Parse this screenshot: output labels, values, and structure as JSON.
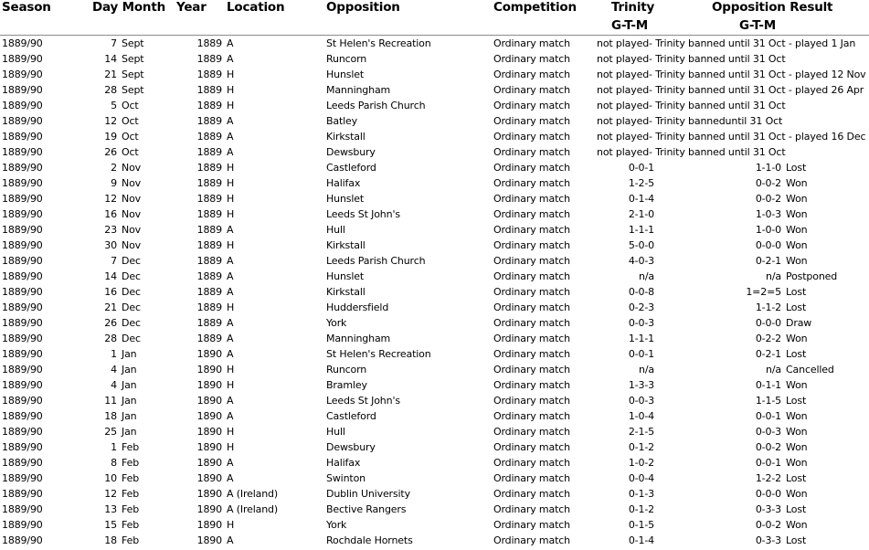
{
  "headers": {
    "season": "Season",
    "day_month": "Day Month",
    "year": "Year",
    "location": "Location",
    "opposition": "Opposition",
    "competition": "Competition",
    "trinity": "Trinity",
    "trinity_sub": "G-T-M",
    "opposition_result": "Opposition Result",
    "opposition_sub": "G-T-M"
  },
  "rows": [
    {
      "season": "1889/90",
      "day": "7",
      "month": "Sept",
      "year": "1889",
      "location": "A",
      "opposition": "St Helen's Recreation",
      "competition": "Ordinary match",
      "note": "not played- Trinity banned until 31 Oct - played 1 Jan"
    },
    {
      "season": "1889/90",
      "day": "14",
      "month": "Sept",
      "year": "1889",
      "location": "A",
      "opposition": "Runcorn",
      "competition": "Ordinary match",
      "note": "not played- Trinity banned until 31 Oct"
    },
    {
      "season": "1889/90",
      "day": "21",
      "month": "Sept",
      "year": "1889",
      "location": "H",
      "opposition": "Hunslet",
      "competition": "Ordinary match",
      "note": "not played- Trinity banned until 31 Oct - played 12 Nov"
    },
    {
      "season": "1889/90",
      "day": "28",
      "month": "Sept",
      "year": "1889",
      "location": "H",
      "opposition": "Manningham",
      "competition": "Ordinary match",
      "note": "not played- Trinity banned until 31 Oct - played 26 Apr"
    },
    {
      "season": "1889/90",
      "day": "5",
      "month": "Oct",
      "year": "1889",
      "location": "H",
      "opposition": "Leeds Parish Church",
      "competition": "Ordinary match",
      "note": "not played- Trinity banned until 31 Oct"
    },
    {
      "season": "1889/90",
      "day": "12",
      "month": "Oct",
      "year": "1889",
      "location": "A",
      "opposition": "Batley",
      "competition": "Ordinary match",
      "note": "not played- Trinity banneduntil 31 Oct"
    },
    {
      "season": "1889/90",
      "day": "19",
      "month": "Oct",
      "year": "1889",
      "location": "A",
      "opposition": "Kirkstall",
      "competition": "Ordinary match",
      "note": "not played- Trinity banned until 31 Oct - played 16 Dec"
    },
    {
      "season": "1889/90",
      "day": "26",
      "month": "Oct",
      "year": "1889",
      "location": "A",
      "opposition": "Dewsbury",
      "competition": "Ordinary match",
      "note": "not played- Trinity banned until 31 Oct"
    },
    {
      "season": "1889/90",
      "day": "2",
      "month": "Nov",
      "year": "1889",
      "location": "H",
      "opposition": "Castleford",
      "competition": "Ordinary match",
      "trinity": "0-0-1",
      "opp_score": "1-1-0",
      "result": "Lost"
    },
    {
      "season": "1889/90",
      "day": "9",
      "month": "Nov",
      "year": "1889",
      "location": "H",
      "opposition": "Halifax",
      "competition": "Ordinary match",
      "trinity": "1-2-5",
      "opp_score": "0-0-2",
      "result": "Won"
    },
    {
      "season": "1889/90",
      "day": "12",
      "month": "Nov",
      "year": "1889",
      "location": "H",
      "opposition": "Hunslet",
      "competition": "Ordinary match",
      "trinity": "0-1-4",
      "opp_score": "0-0-2",
      "result": "Won"
    },
    {
      "season": "1889/90",
      "day": "16",
      "month": "Nov",
      "year": "1889",
      "location": "H",
      "opposition": "Leeds St John's",
      "competition": "Ordinary match",
      "trinity": "2-1-0",
      "opp_score": "1-0-3",
      "result": "Won"
    },
    {
      "season": "1889/90",
      "day": "23",
      "month": "Nov",
      "year": "1889",
      "location": "A",
      "opposition": "Hull",
      "competition": "Ordinary match",
      "trinity": "1-1-1",
      "opp_score": "1-0-0",
      "result": "Won"
    },
    {
      "season": "1889/90",
      "day": "30",
      "month": "Nov",
      "year": "1889",
      "location": "H",
      "opposition": "Kirkstall",
      "competition": "Ordinary match",
      "trinity": "5-0-0",
      "opp_score": "0-0-0",
      "result": "Won"
    },
    {
      "season": "1889/90",
      "day": "7",
      "month": "Dec",
      "year": "1889",
      "location": "A",
      "opposition": "Leeds Parish Church",
      "competition": "Ordinary match",
      "trinity": "4-0-3",
      "opp_score": "0-2-1",
      "result": "Won"
    },
    {
      "season": "1889/90",
      "day": "14",
      "month": "Dec",
      "year": "1889",
      "location": "A",
      "opposition": "Hunslet",
      "competition": "Ordinary match",
      "trinity": "n/a",
      "opp_score": "n/a",
      "result": "Postponed"
    },
    {
      "season": "1889/90",
      "day": "16",
      "month": "Dec",
      "year": "1889",
      "location": "A",
      "opposition": "Kirkstall",
      "competition": "Ordinary match",
      "trinity": "0-0-8",
      "opp_score": "1=2=5",
      "result": "Lost"
    },
    {
      "season": "1889/90",
      "day": "21",
      "month": "Dec",
      "year": "1889",
      "location": "H",
      "opposition": "Huddersfield",
      "competition": "Ordinary match",
      "trinity": "0-2-3",
      "opp_score": "1-1-2",
      "result": "Lost"
    },
    {
      "season": "1889/90",
      "day": "26",
      "month": "Dec",
      "year": "1889",
      "location": "A",
      "opposition": "York",
      "competition": "Ordinary match",
      "trinity": "0-0-3",
      "opp_score": "0-0-0",
      "result": "Draw"
    },
    {
      "season": "1889/90",
      "day": "28",
      "month": "Dec",
      "year": "1889",
      "location": "A",
      "opposition": "Manningham",
      "competition": "Ordinary match",
      "trinity": "1-1-1",
      "opp_score": "0-2-2",
      "result": "Won"
    },
    {
      "season": "1889/90",
      "day": "1",
      "month": "Jan",
      "year": "1890",
      "location": "A",
      "opposition": "St Helen's Recreation",
      "competition": "Ordinary match",
      "trinity": "0-0-1",
      "opp_score": "0-2-1",
      "result": "Lost"
    },
    {
      "season": "1889/90",
      "day": "4",
      "month": "Jan",
      "year": "1890",
      "location": "H",
      "opposition": "Runcorn",
      "competition": "Ordinary match",
      "trinity": "n/a",
      "opp_score": "n/a",
      "result": "Cancelled"
    },
    {
      "season": "1889/90",
      "day": "4",
      "month": "Jan",
      "year": "1890",
      "location": "H",
      "opposition": "Bramley",
      "competition": "Ordinary match",
      "trinity": "1-3-3",
      "opp_score": "0-1-1",
      "result": "Won"
    },
    {
      "season": "1889/90",
      "day": "11",
      "month": "Jan",
      "year": "1890",
      "location": "A",
      "opposition": "Leeds St John's",
      "competition": "Ordinary match",
      "trinity": "0-0-3",
      "opp_score": "1-1-5",
      "result": "Lost"
    },
    {
      "season": "1889/90",
      "day": "18",
      "month": "Jan",
      "year": "1890",
      "location": "A",
      "opposition": "Castleford",
      "competition": "Ordinary match",
      "trinity": "1-0-4",
      "opp_score": "0-0-1",
      "result": "Won"
    },
    {
      "season": "1889/90",
      "day": "25",
      "month": "Jan",
      "year": "1890",
      "location": "H",
      "opposition": "Hull",
      "competition": "Ordinary match",
      "trinity": "2-1-5",
      "opp_score": "0-0-3",
      "result": "Won"
    },
    {
      "season": "1889/90",
      "day": "1",
      "month": "Feb",
      "year": "1890",
      "location": "H",
      "opposition": "Dewsbury",
      "competition": "Ordinary match",
      "trinity": "0-1-2",
      "opp_score": "0-0-2",
      "result": "Won"
    },
    {
      "season": "1889/90",
      "day": "8",
      "month": "Feb",
      "year": "1890",
      "location": "A",
      "opposition": "Halifax",
      "competition": "Ordinary match",
      "trinity": "1-0-2",
      "opp_score": "0-0-1",
      "result": "Won"
    },
    {
      "season": "1889/90",
      "day": "10",
      "month": "Feb",
      "year": "1890",
      "location": "A",
      "opposition": "Swinton",
      "competition": "Ordinary match",
      "trinity": "0-0-4",
      "opp_score": "1-2-2",
      "result": "Lost"
    },
    {
      "season": "1889/90",
      "day": "12",
      "month": "Feb",
      "year": "1890",
      "location": "A (Ireland)",
      "opposition": "Dublin University",
      "competition": "Ordinary match",
      "trinity": "0-1-3",
      "opp_score": "0-0-0",
      "result": "Won"
    },
    {
      "season": "1889/90",
      "day": "13",
      "month": "Feb",
      "year": "1890",
      "location": "A (Ireland)",
      "opposition": "Bective Rangers",
      "competition": "Ordinary match",
      "trinity": "0-1-2",
      "opp_score": "0-3-3",
      "result": "Lost"
    },
    {
      "season": "1889/90",
      "day": "15",
      "month": "Feb",
      "year": "1890",
      "location": "H",
      "opposition": "York",
      "competition": "Ordinary match",
      "trinity": "0-1-5",
      "opp_score": "0-0-2",
      "result": "Won"
    },
    {
      "season": "1889/90",
      "day": "18",
      "month": "Feb",
      "year": "1890",
      "location": "A",
      "opposition": "Rochdale Hornets",
      "competition": "Ordinary match",
      "trinity": "0-1-4",
      "opp_score": "0-3-3",
      "result": "Lost"
    }
  ]
}
